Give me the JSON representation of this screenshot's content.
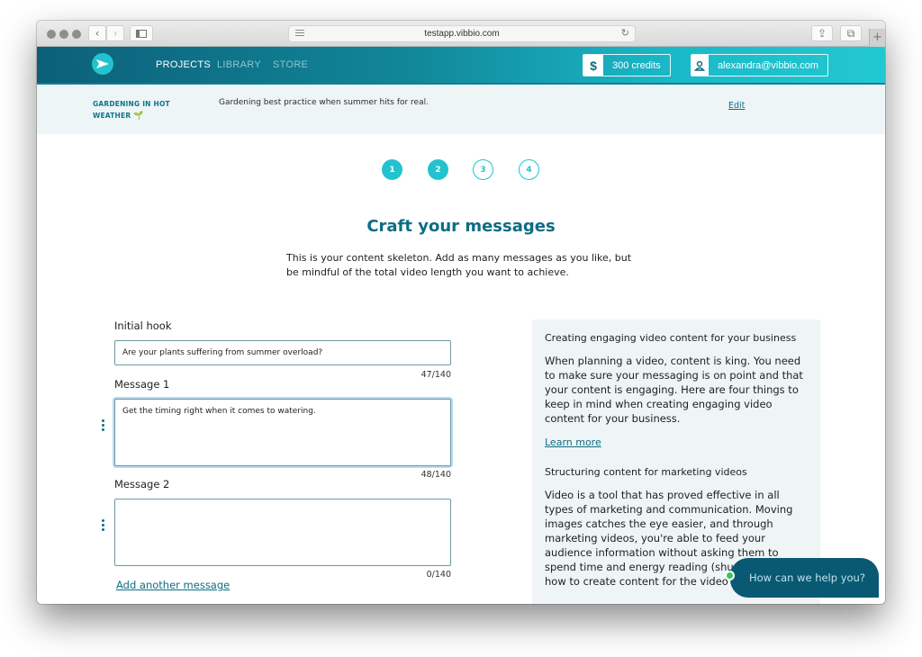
{
  "browser": {
    "url": "testapp.vibbio.com",
    "back": "‹",
    "forward": "›",
    "reload": "↻",
    "share": "⇪",
    "tabs": "⧉",
    "new_tab": "+"
  },
  "header": {
    "nav": [
      {
        "label": "PROJECTS",
        "active": true
      },
      {
        "label": "LIBRARY",
        "active": false
      },
      {
        "label": "STORE",
        "active": false
      }
    ],
    "credits": {
      "icon": "$",
      "label": "300 credits"
    },
    "account": {
      "icon": "user-icon",
      "label": "alexandra@vibbio.com"
    }
  },
  "project": {
    "title": "GARDENING IN HOT WEATHER",
    "title_icon": "🌱",
    "description": "Gardening best practice when summer hits for real.",
    "edit_label": "Edit"
  },
  "steps": [
    {
      "label": "1",
      "state": "done"
    },
    {
      "label": "2",
      "state": "done"
    },
    {
      "label": "3",
      "state": "todo"
    },
    {
      "label": "4",
      "state": "todo"
    }
  ],
  "main": {
    "heading": "Craft your messages",
    "subtext": "This is your content skeleton. Add as many messages as you like, but be mindful of the total video length you want to achieve."
  },
  "form": {
    "hook": {
      "label": "Initial hook",
      "value": "Are your plants suffering from summer overload?",
      "counter": "47/140"
    },
    "messages": [
      {
        "label": "Message 1",
        "value": "Get the timing right when it comes to watering.",
        "counter": "48/140"
      },
      {
        "label": "Message 2",
        "value": "",
        "counter": "0/140"
      }
    ],
    "add_label": "Add another message"
  },
  "side": {
    "h1": "Creating engaging video content for your business",
    "p1": "When planning a video, content is king. You need to make sure your messaging is on point and that your content is engaging. Here are four things to keep in mind when creating engaging video content for your business.",
    "link1": "Learn more",
    "h2": "Structuring content for marketing videos",
    "p2": "Video is a tool that has proved effective in all types of marketing and communication. Moving images catches the eye easier, and through marketing videos, you're able to feed your audience information without asking them to spend time and energy reading (shudder!). But how to create content for the video format?"
  },
  "chat": {
    "label": "How can we help you?",
    "status_color": "#3bc45a"
  }
}
